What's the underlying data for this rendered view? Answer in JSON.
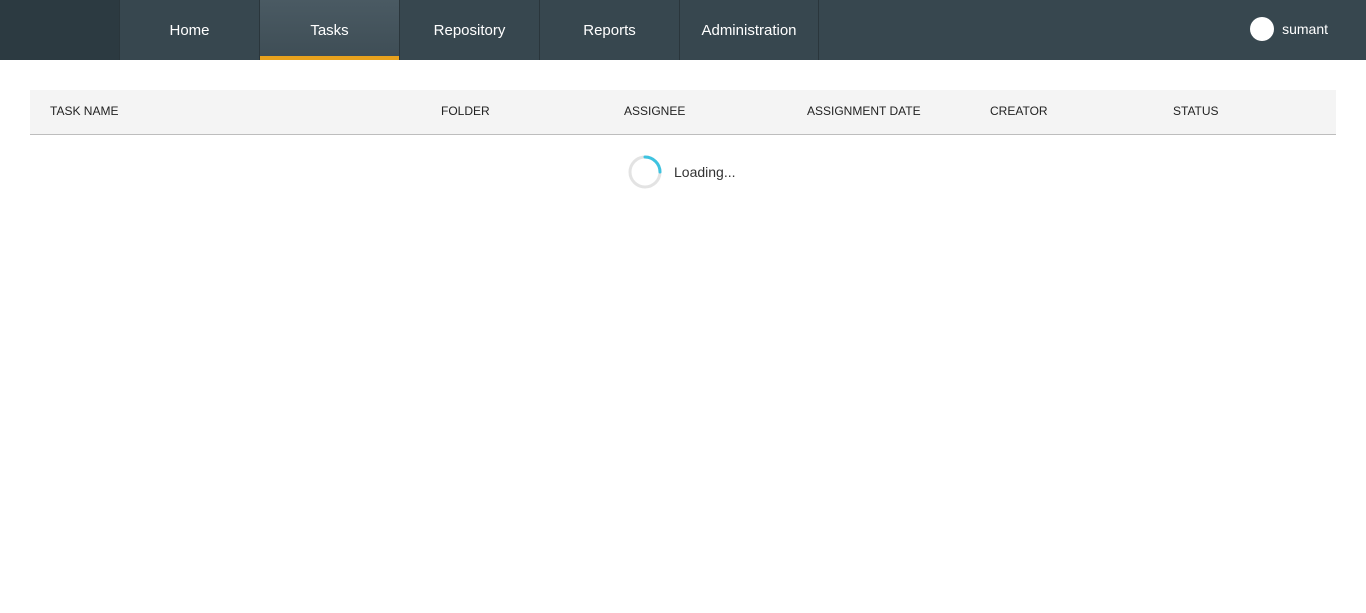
{
  "nav": {
    "items": [
      {
        "label": "Home",
        "active": false
      },
      {
        "label": "Tasks",
        "active": true
      },
      {
        "label": "Repository",
        "active": false
      },
      {
        "label": "Reports",
        "active": false
      },
      {
        "label": "Administration",
        "active": false
      }
    ]
  },
  "user": {
    "name": "sumant",
    "avatar_icon": "user-avatar-icon"
  },
  "table": {
    "columns": [
      "TASK NAME",
      "FOLDER",
      "ASSIGNEE",
      "ASSIGNMENT DATE",
      "CREATOR",
      "STATUS"
    ]
  },
  "status": {
    "loading_text": "Loading...",
    "spinner_icon": "spinner-icon"
  },
  "colors": {
    "topbar": "#37474f",
    "active_tab_indicator": "#e8a21d",
    "spinner_accent": "#3ec3e0",
    "header_background": "#f4f4f4"
  }
}
